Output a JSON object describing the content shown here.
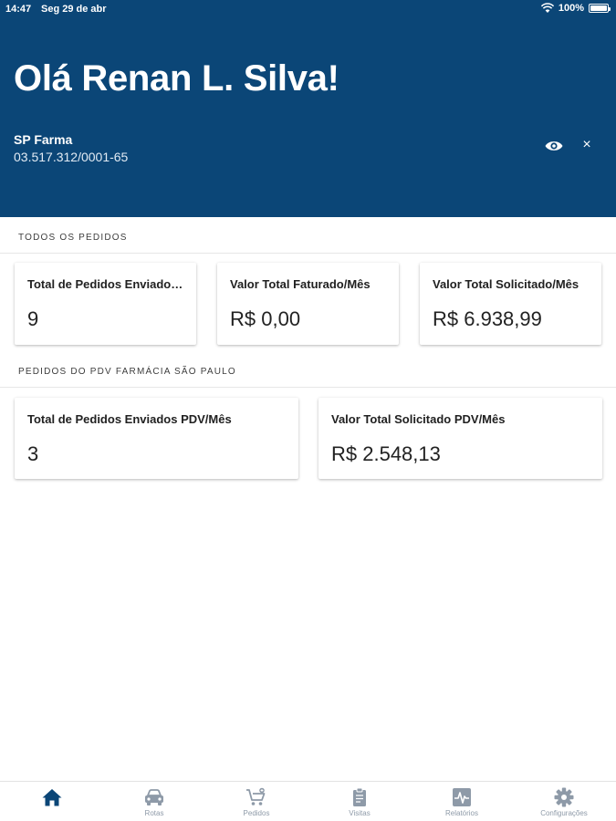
{
  "status_bar": {
    "time": "14:47",
    "date": "Seg 29 de abr",
    "battery": "100%",
    "battery_level": 1.0
  },
  "header": {
    "greeting": "Olá Renan L. Silva!",
    "company_name": "SP Farma",
    "cnpj": "03.517.312/0001-65",
    "close_symbol": "×",
    "icons": {
      "visibility": "eye-icon",
      "close": "close-icon"
    },
    "background_color": "#0b4677"
  },
  "section_all_orders": {
    "label": "TODOS OS PEDIDOS",
    "cards": [
      {
        "title": "Total de Pedidos Enviados/Mês",
        "value": "9"
      },
      {
        "title": "Valor Total Faturado/Mês",
        "value": "R$ 0,00"
      },
      {
        "title": "Valor Total Solicitado/Mês",
        "value": "R$ 6.938,99"
      }
    ]
  },
  "section_pdv_orders": {
    "label": "PEDIDOS DO PDV FARMÁCIA SÃO PAULO",
    "cards": [
      {
        "title": "Total de Pedidos Enviados PDV/Mês",
        "value": "3"
      },
      {
        "title": "Valor Total Solicitado PDV/Mês",
        "value": "R$ 2.548,13"
      }
    ]
  },
  "bottom_nav": {
    "active_color": "#0b4677",
    "inactive_color": "#8e9aa8",
    "items": [
      {
        "label": "",
        "icon": "home-icon",
        "active": true
      },
      {
        "label": "Rotas",
        "icon": "car-icon",
        "active": false
      },
      {
        "label": "Pedidos",
        "icon": "cart-icon",
        "active": false
      },
      {
        "label": "Visitas",
        "icon": "clipboard-icon",
        "active": false
      },
      {
        "label": "Relatórios",
        "icon": "report-icon",
        "active": false
      },
      {
        "label": "Configurações",
        "icon": "gear-icon",
        "active": false
      }
    ]
  }
}
